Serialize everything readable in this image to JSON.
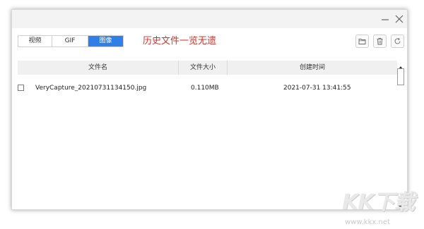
{
  "window": {
    "minimize_icon": "minimize-icon",
    "close_icon": "close-icon"
  },
  "tabs": [
    {
      "label": "视频",
      "active": false
    },
    {
      "label": "GIF",
      "active": false
    },
    {
      "label": "图像",
      "active": true
    }
  ],
  "history_title": "历史文件一览无遗",
  "toolbar": {
    "folder_icon": "folder-icon",
    "delete_icon": "trash-icon",
    "refresh_icon": "refresh-icon"
  },
  "table": {
    "columns": [
      "文件名",
      "文件大小",
      "创建时间"
    ],
    "rows": [
      {
        "checked": false,
        "name": "VeryCapture_20210731134150.jpg",
        "size": "0.110MB",
        "created": "2021-07-31 13:41:55"
      }
    ]
  },
  "watermark": {
    "logo": "KK下载",
    "url": "www.kkx.net"
  },
  "colors": {
    "accent": "#2f7fe6",
    "title_red": "#d9302b"
  }
}
